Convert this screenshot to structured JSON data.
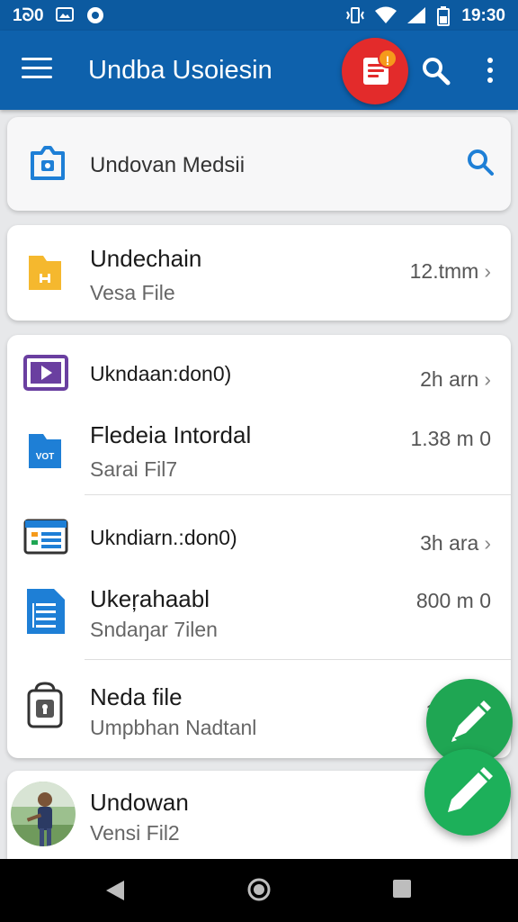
{
  "status_bar": {
    "time_left": "1ᘐ0",
    "time_right": "19:30"
  },
  "app_bar": {
    "title": "Undba Usoiesin",
    "badge_count": "!"
  },
  "search_card": {
    "label": "Undovan Medsii"
  },
  "card1": {
    "rows": [
      {
        "name": "Undechain",
        "sub": "Vesa File",
        "meta": "12.tmm",
        "icon": "folder-icon",
        "color": "#f5b82e"
      }
    ]
  },
  "card2": {
    "rows": [
      {
        "header": "Ukndaan:don0)",
        "meta": "2h arn",
        "icon": "video-icon",
        "color": "#6a3fa0"
      },
      {
        "name": "Fledeia Intordal",
        "sub": "Sarai Fil7",
        "meta": "1.38 m 0",
        "icon": "folder-icon",
        "color": "#1e7fd6"
      },
      {
        "header": "Ukndiarn.:don0)",
        "meta": "3h ara",
        "icon": "calendar-icon",
        "color": "#1e7fd6"
      },
      {
        "name": "Ukeŗahaabl",
        "sub": "Sndaŋar 7ilen",
        "meta": "800 m 0",
        "icon": "document-icon",
        "color": "#1e7fd6"
      },
      {
        "name": "Neda file",
        "sub": "Umpbhan Nadtanl",
        "meta": "1",
        "icon": "lock-file-icon",
        "color": "#333"
      }
    ]
  },
  "card3": {
    "rows": [
      {
        "name": "Undowan",
        "sub": "Vensi Fil2",
        "icon": "avatar"
      }
    ]
  },
  "colors": {
    "primary": "#0e61ac",
    "accent_red": "#e32b2b",
    "fab_green": "#1fa653"
  }
}
